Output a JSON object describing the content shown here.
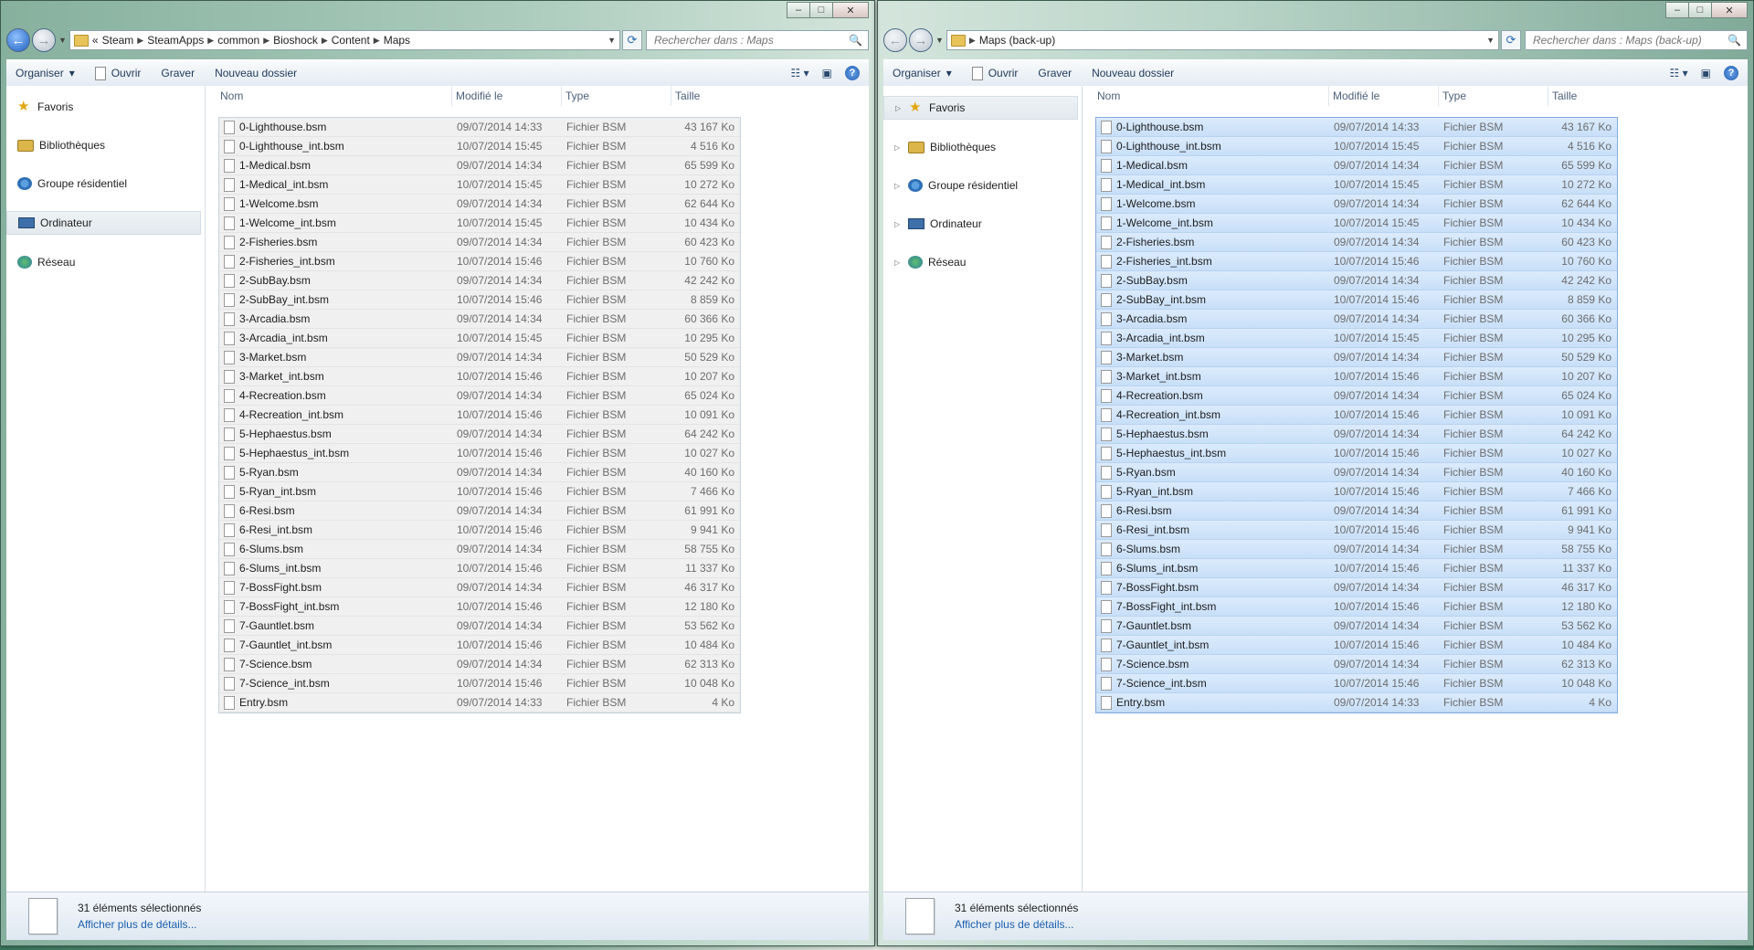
{
  "files": [
    {
      "name": "0-Lighthouse.bsm",
      "date": "09/07/2014 14:33",
      "type": "Fichier BSM",
      "size": "43 167 Ko"
    },
    {
      "name": "0-Lighthouse_int.bsm",
      "date": "10/07/2014 15:45",
      "type": "Fichier BSM",
      "size": "4 516 Ko"
    },
    {
      "name": "1-Medical.bsm",
      "date": "09/07/2014 14:34",
      "type": "Fichier BSM",
      "size": "65 599 Ko"
    },
    {
      "name": "1-Medical_int.bsm",
      "date": "10/07/2014 15:45",
      "type": "Fichier BSM",
      "size": "10 272 Ko"
    },
    {
      "name": "1-Welcome.bsm",
      "date": "09/07/2014 14:34",
      "type": "Fichier BSM",
      "size": "62 644 Ko"
    },
    {
      "name": "1-Welcome_int.bsm",
      "date": "10/07/2014 15:45",
      "type": "Fichier BSM",
      "size": "10 434 Ko"
    },
    {
      "name": "2-Fisheries.bsm",
      "date": "09/07/2014 14:34",
      "type": "Fichier BSM",
      "size": "60 423 Ko"
    },
    {
      "name": "2-Fisheries_int.bsm",
      "date": "10/07/2014 15:46",
      "type": "Fichier BSM",
      "size": "10 760 Ko"
    },
    {
      "name": "2-SubBay.bsm",
      "date": "09/07/2014 14:34",
      "type": "Fichier BSM",
      "size": "42 242 Ko"
    },
    {
      "name": "2-SubBay_int.bsm",
      "date": "10/07/2014 15:46",
      "type": "Fichier BSM",
      "size": "8 859 Ko"
    },
    {
      "name": "3-Arcadia.bsm",
      "date": "09/07/2014 14:34",
      "type": "Fichier BSM",
      "size": "60 366 Ko"
    },
    {
      "name": "3-Arcadia_int.bsm",
      "date": "10/07/2014 15:45",
      "type": "Fichier BSM",
      "size": "10 295 Ko"
    },
    {
      "name": "3-Market.bsm",
      "date": "09/07/2014 14:34",
      "type": "Fichier BSM",
      "size": "50 529 Ko"
    },
    {
      "name": "3-Market_int.bsm",
      "date": "10/07/2014 15:46",
      "type": "Fichier BSM",
      "size": "10 207 Ko"
    },
    {
      "name": "4-Recreation.bsm",
      "date": "09/07/2014 14:34",
      "type": "Fichier BSM",
      "size": "65 024 Ko"
    },
    {
      "name": "4-Recreation_int.bsm",
      "date": "10/07/2014 15:46",
      "type": "Fichier BSM",
      "size": "10 091 Ko"
    },
    {
      "name": "5-Hephaestus.bsm",
      "date": "09/07/2014 14:34",
      "type": "Fichier BSM",
      "size": "64 242 Ko"
    },
    {
      "name": "5-Hephaestus_int.bsm",
      "date": "10/07/2014 15:46",
      "type": "Fichier BSM",
      "size": "10 027 Ko"
    },
    {
      "name": "5-Ryan.bsm",
      "date": "09/07/2014 14:34",
      "type": "Fichier BSM",
      "size": "40 160 Ko"
    },
    {
      "name": "5-Ryan_int.bsm",
      "date": "10/07/2014 15:46",
      "type": "Fichier BSM",
      "size": "7 466 Ko"
    },
    {
      "name": "6-Resi.bsm",
      "date": "09/07/2014 14:34",
      "type": "Fichier BSM",
      "size": "61 991 Ko"
    },
    {
      "name": "6-Resi_int.bsm",
      "date": "10/07/2014 15:46",
      "type": "Fichier BSM",
      "size": "9 941 Ko"
    },
    {
      "name": "6-Slums.bsm",
      "date": "09/07/2014 14:34",
      "type": "Fichier BSM",
      "size": "58 755 Ko"
    },
    {
      "name": "6-Slums_int.bsm",
      "date": "10/07/2014 15:46",
      "type": "Fichier BSM",
      "size": "11 337 Ko"
    },
    {
      "name": "7-BossFight.bsm",
      "date": "09/07/2014 14:34",
      "type": "Fichier BSM",
      "size": "46 317 Ko"
    },
    {
      "name": "7-BossFight_int.bsm",
      "date": "10/07/2014 15:46",
      "type": "Fichier BSM",
      "size": "12 180 Ko"
    },
    {
      "name": "7-Gauntlet.bsm",
      "date": "09/07/2014 14:34",
      "type": "Fichier BSM",
      "size": "53 562 Ko"
    },
    {
      "name": "7-Gauntlet_int.bsm",
      "date": "10/07/2014 15:46",
      "type": "Fichier BSM",
      "size": "10 484 Ko"
    },
    {
      "name": "7-Science.bsm",
      "date": "09/07/2014 14:34",
      "type": "Fichier BSM",
      "size": "62 313 Ko"
    },
    {
      "name": "7-Science_int.bsm",
      "date": "10/07/2014 15:46",
      "type": "Fichier BSM",
      "size": "10 048 Ko"
    },
    {
      "name": "Entry.bsm",
      "date": "09/07/2014 14:33",
      "type": "Fichier BSM",
      "size": "4 Ko"
    }
  ],
  "columns": {
    "name": "Nom",
    "date": "Modifié le",
    "type": "Type",
    "size": "Taille"
  },
  "toolbar": {
    "organize": "Organiser",
    "open": "Ouvrir",
    "burn": "Graver",
    "new_folder": "Nouveau dossier"
  },
  "nav_items": [
    "Favoris",
    "Bibliothèques",
    "Groupe résidentiel",
    "Ordinateur",
    "Réseau"
  ],
  "status": {
    "selected": "31 éléments sélectionnés",
    "details_link": "Afficher plus de détails..."
  },
  "left_window": {
    "breadcrumb": [
      "«",
      "Steam",
      "SteamApps",
      "common",
      "Bioshock",
      "Content",
      "Maps"
    ],
    "search_placeholder": "Rechercher dans : Maps"
  },
  "right_window": {
    "breadcrumb": [
      "Maps (back-up)"
    ],
    "search_placeholder": "Rechercher dans : Maps (back-up)"
  },
  "icons": {
    "back": "back-arrow-icon",
    "forward": "forward-arrow-icon",
    "refresh": "refresh-icon",
    "search": "search-icon",
    "help": "help-icon"
  }
}
